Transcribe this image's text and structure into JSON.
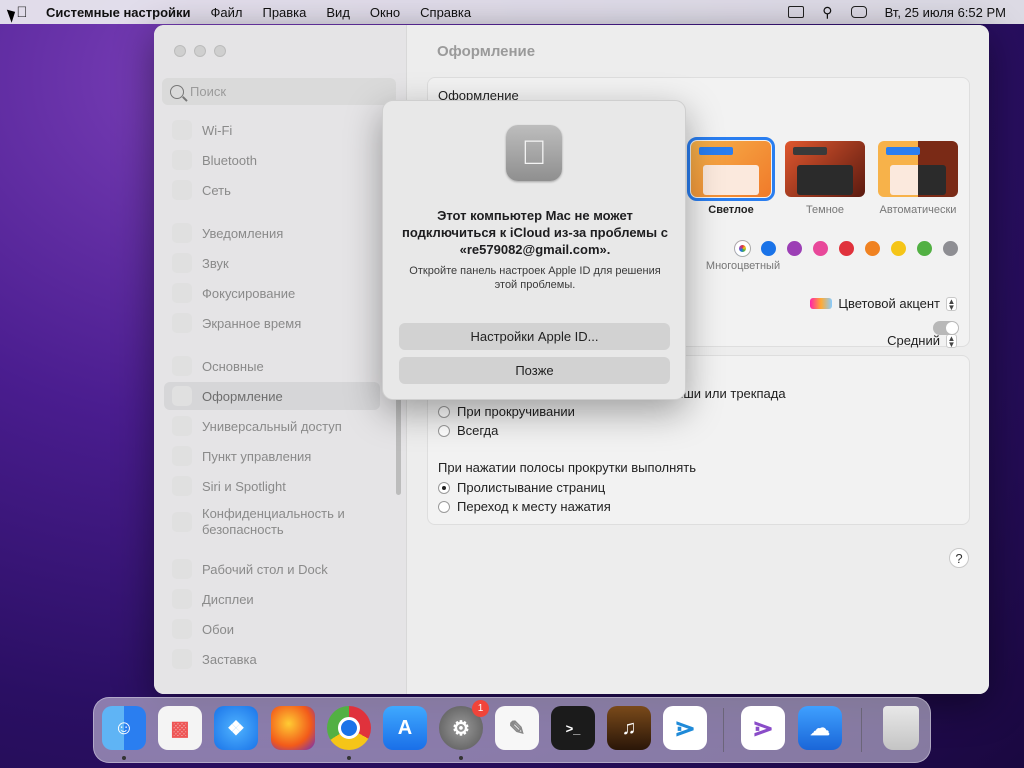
{
  "menubar": {
    "app_name": "Системные настройки",
    "items": [
      "Файл",
      "Правка",
      "Вид",
      "Окно",
      "Справка"
    ],
    "clock": "Вт, 25 июля  6:52 PM"
  },
  "sidebar": {
    "search_placeholder": "Поиск",
    "items": [
      {
        "label": "Wi-Fi"
      },
      {
        "label": "Bluetooth"
      },
      {
        "label": "Сеть"
      },
      {
        "label": "Уведомления"
      },
      {
        "label": "Звук"
      },
      {
        "label": "Фокусирование"
      },
      {
        "label": "Экранное время"
      },
      {
        "label": "Основные"
      },
      {
        "label": "Оформление",
        "selected": true
      },
      {
        "label": "Универсальный доступ"
      },
      {
        "label": "Пункт управления"
      },
      {
        "label": "Siri и Spotlight"
      },
      {
        "label": "Конфиденциальность и безопасность"
      },
      {
        "label": "Рабочий стол и Dock"
      },
      {
        "label": "Дисплеи"
      },
      {
        "label": "Обои"
      },
      {
        "label": "Заставка"
      }
    ]
  },
  "content": {
    "title": "Оформление",
    "appearance_label": "Оформление",
    "themes": [
      {
        "name": "Светлое",
        "selected": true
      },
      {
        "name": "Темное"
      },
      {
        "name": "Автоматически"
      }
    ],
    "accent_colors": [
      "#multi",
      "#1a73e8",
      "#9c3fb5",
      "#e8489a",
      "#e0323c",
      "#f08221",
      "#f5c518",
      "#52b043",
      "#8e8e93"
    ],
    "accent_multicolor_label": "Многоцветный",
    "highlight_select": "Цветовой акцент",
    "sidebar_size_select": "Средний",
    "scroll_show_partial": "ыши или трекпада",
    "scroll_options": [
      "При прокручивании",
      "Всегда"
    ],
    "click_label": "При нажатии полосы прокрутки выполнять",
    "click_options": [
      {
        "label": "Пролистывание страниц",
        "selected": true
      },
      {
        "label": "Переход к месту нажатия",
        "selected": false
      }
    ],
    "help": "?"
  },
  "dialog": {
    "title": "Этот компьютер Mac не может подключиться к iCloud из-за проблемы с «re579082@gmail.com».",
    "message": "Откройте панель настроек Apple ID для решения этой проблемы.",
    "primary_button": "Настройки Apple ID...",
    "secondary_button": "Позже"
  },
  "dock": {
    "apps": [
      "finder-icon",
      "launchpad-icon",
      "safari-icon",
      "firefox-icon",
      "chrome-icon",
      "app-store-icon",
      "system-settings-icon",
      "textedit-icon",
      "terminal-icon",
      "garageband-icon",
      "vscode-icon",
      "visual-studio-icon",
      "weather-icon",
      "trash-icon"
    ],
    "settings_badge": "1"
  }
}
